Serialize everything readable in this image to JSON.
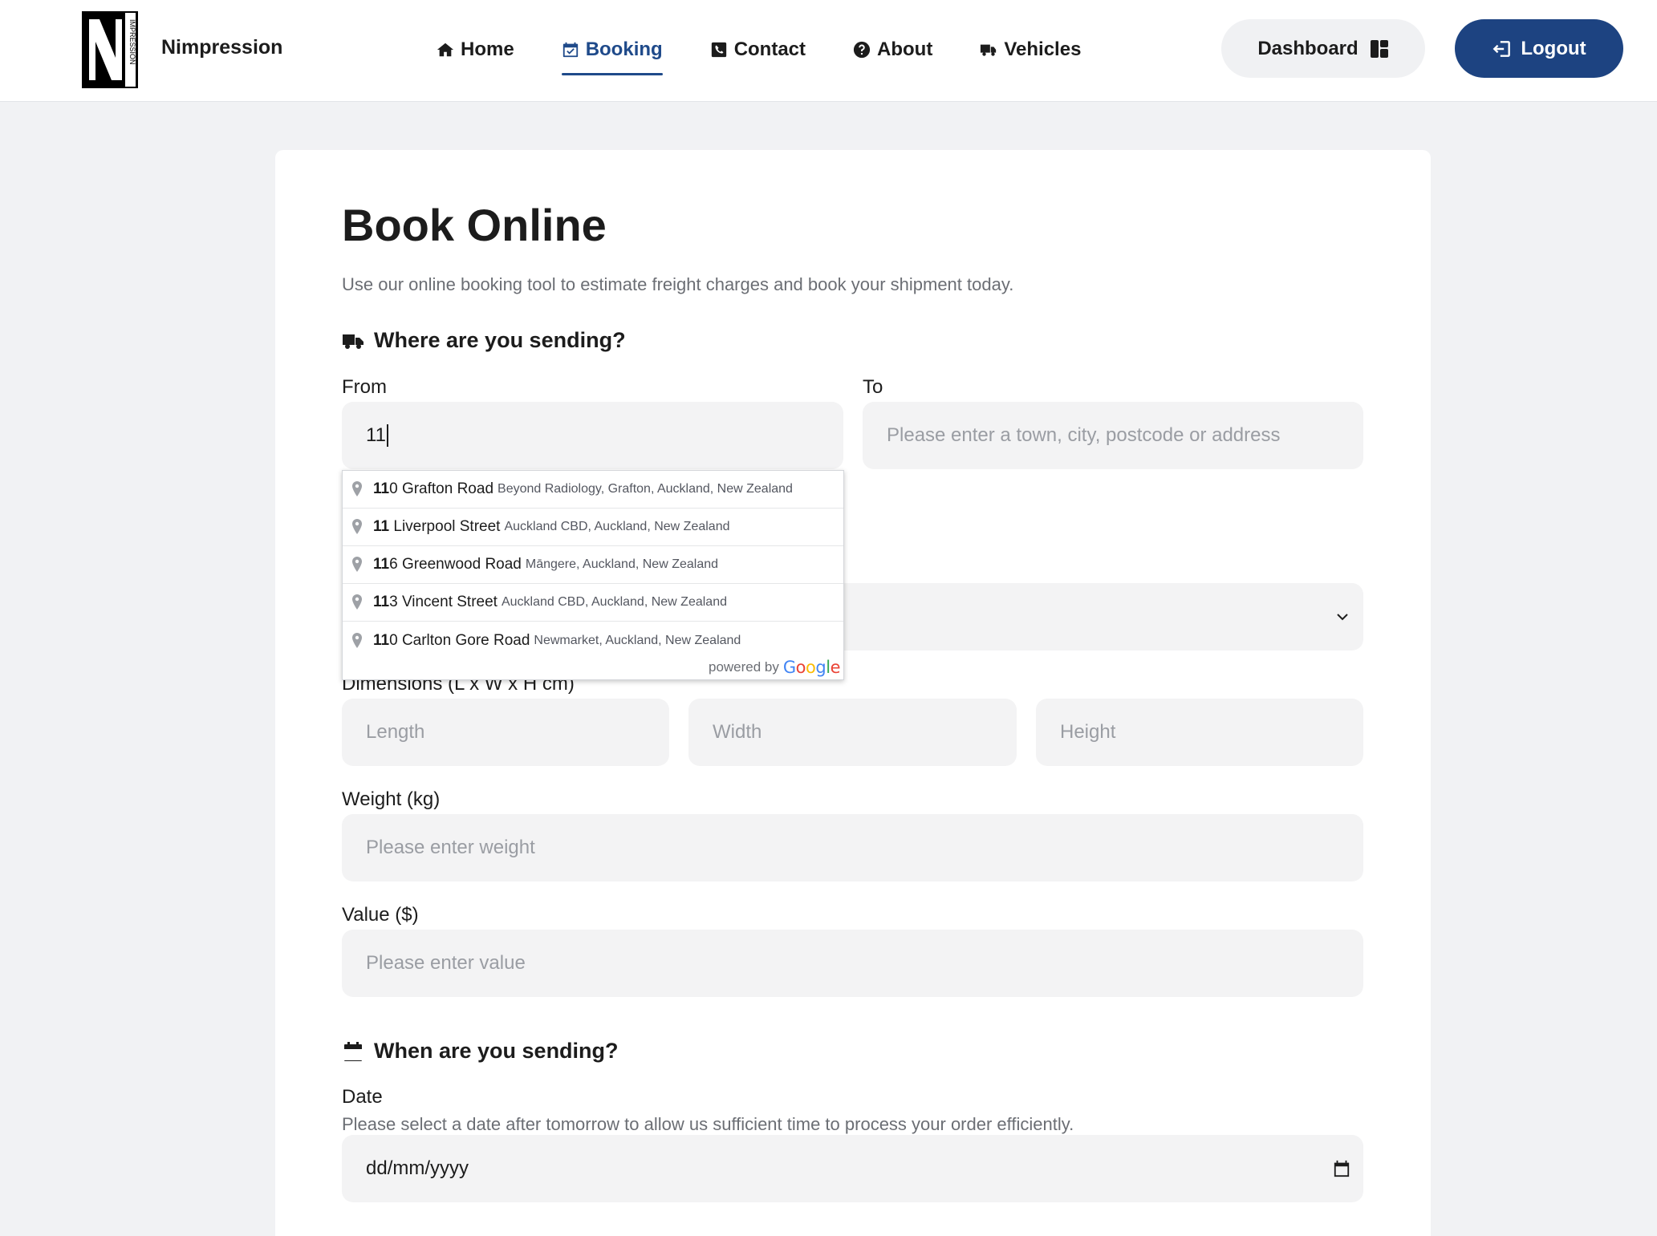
{
  "header": {
    "brand": "Nimpression",
    "logo_letter": "N",
    "logo_side_text": "IMPRESSION",
    "nav": [
      {
        "label": "Home",
        "icon": "home-icon"
      },
      {
        "label": "Booking",
        "icon": "calendar-check-icon",
        "active": true
      },
      {
        "label": "Contact",
        "icon": "phone-square-icon"
      },
      {
        "label": "About",
        "icon": "question-circle-icon"
      },
      {
        "label": "Vehicles",
        "icon": "truck-icon"
      }
    ],
    "dashboard_label": "Dashboard",
    "logout_label": "Logout"
  },
  "page": {
    "title": "Book Online",
    "subtitle": "Use our online booking tool to estimate freight charges and book your shipment today."
  },
  "where": {
    "heading": "Where are you sending?",
    "from_label": "From",
    "from_value": "11",
    "to_label": "To",
    "to_placeholder": "Please enter a town, city, postcode or address"
  },
  "autocomplete": {
    "items": [
      {
        "match": "11",
        "rest": "0 Grafton Road",
        "secondary": "Beyond Radiology, Grafton, Auckland, New Zealand"
      },
      {
        "match": "11",
        "rest": " Liverpool Street",
        "secondary": "Auckland CBD, Auckland, New Zealand"
      },
      {
        "match": "11",
        "rest": "6 Greenwood Road",
        "secondary": "Māngere, Auckland, New Zealand"
      },
      {
        "match": "11",
        "rest": "3 Vincent Street",
        "secondary": "Auckland CBD, Auckland, New Zealand"
      },
      {
        "match": "11",
        "rest": "0 Carlton Gore Road",
        "secondary": "Newmarket, Auckland, New Zealand"
      }
    ],
    "powered_by": "powered by",
    "google": "Google"
  },
  "package": {
    "dimensions_label": "Dimensions (L x W x H cm)",
    "length_placeholder": "Length",
    "width_placeholder": "Width",
    "height_placeholder": "Height",
    "weight_label": "Weight (kg)",
    "weight_placeholder": "Please enter weight",
    "value_label": "Value ($)",
    "value_placeholder": "Please enter value"
  },
  "when": {
    "heading": "When are you sending?",
    "date_label": "Date",
    "date_help": "Please select a date after tomorrow to allow us sufficient time to process your order efficiently.",
    "date_placeholder": "dd/mm/yyyy"
  },
  "colors": {
    "accent": "#1d4381",
    "active_nav": "#1f4a8a",
    "field_bg": "#f3f3f4",
    "page_bg": "#f1f2f4"
  }
}
